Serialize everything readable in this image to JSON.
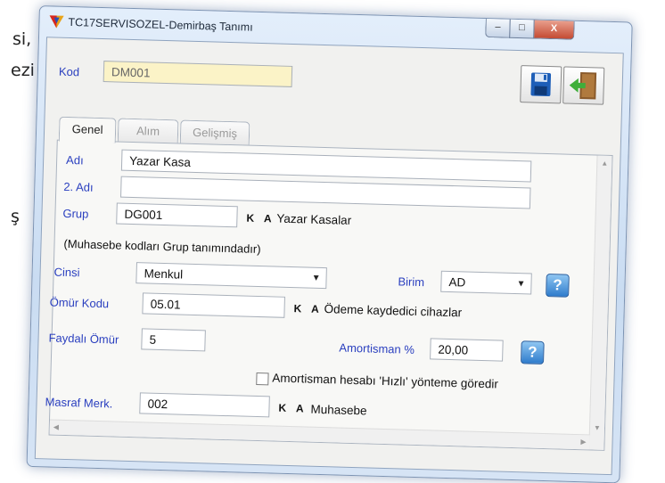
{
  "background": {
    "line1": "si,",
    "line2": "ezi",
    "line3": "ş"
  },
  "window": {
    "title": "TC17SERVISOZEL-Demirbaş Tanımı",
    "min_glyph": "–",
    "max_glyph": "□",
    "close_glyph": "X"
  },
  "kod": {
    "label": "Kod",
    "value": "DM001"
  },
  "tabs": [
    {
      "label": "Genel",
      "active": true
    },
    {
      "label": "Alım",
      "active": false
    },
    {
      "label": "Gelişmiş",
      "active": false
    }
  ],
  "form": {
    "adi": {
      "label": "Adı",
      "value": "Yazar Kasa"
    },
    "adi2": {
      "label": "2. Adı",
      "value": ""
    },
    "grup": {
      "label": "Grup",
      "value": "DG001",
      "ka": "K A",
      "desc": "Yazar Kasalar"
    },
    "note": "(Muhasebe kodları Grup tanımındadır)",
    "cinsi": {
      "label": "Cinsi",
      "value": "Menkul"
    },
    "birim": {
      "label": "Birim",
      "value": "AD"
    },
    "omur_kodu": {
      "label": "Ömür Kodu",
      "value": "05.01",
      "ka": "K A",
      "desc": "Ödeme kaydedici cihazlar"
    },
    "faydali_omur": {
      "label": "Faydalı Ömür",
      "value": "5"
    },
    "amortisman": {
      "label": "Amortisman %",
      "value": "20,00"
    },
    "hizli": {
      "label": "Amortisman hesabı 'Hızlı' yönteme göredir",
      "checked": false
    },
    "masraf": {
      "label": "Masraf Merk.",
      "value": "002",
      "ka": "K A",
      "desc": "Muhasebe"
    },
    "help_glyph": "?"
  },
  "colors": {
    "label_blue": "#2a3fbf",
    "kod_bg": "#fbf3c7",
    "help_blue": "#2f7ccc"
  }
}
